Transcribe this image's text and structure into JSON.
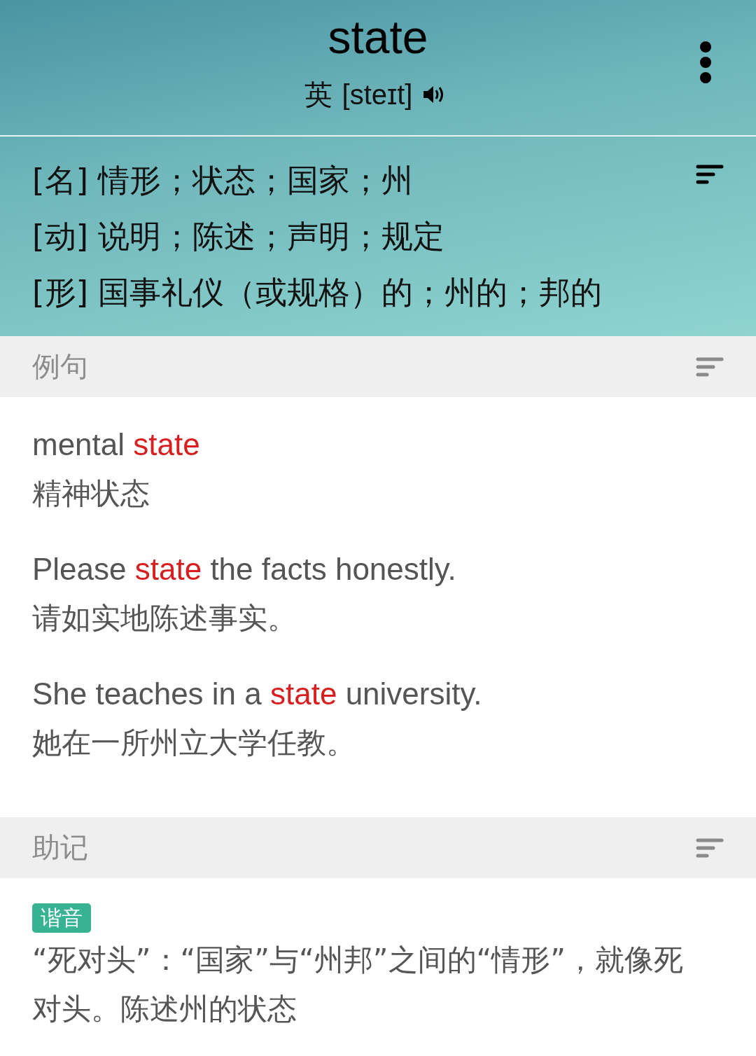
{
  "header": {
    "word": "state",
    "accent": "英",
    "phonetic": "[steɪt]"
  },
  "definitions": [
    {
      "pos": "[名]",
      "meaning": "情形；状态；国家；州"
    },
    {
      "pos": "[动]",
      "meaning": "说明；陈述；声明；规定"
    },
    {
      "pos": "[形]",
      "meaning": "国事礼仪（或规格）的；州的；邦的"
    }
  ],
  "examples_section": {
    "title": "例句",
    "items": [
      {
        "english": [
          {
            "text": "mental ",
            "highlight": false
          },
          {
            "text": "state",
            "highlight": true
          }
        ],
        "chinese": "精神状态"
      },
      {
        "english": [
          {
            "text": "Please ",
            "highlight": false
          },
          {
            "text": "state",
            "highlight": true
          },
          {
            "text": " the facts honestly.",
            "highlight": false
          }
        ],
        "chinese": "请如实地陈述事实。"
      },
      {
        "english": [
          {
            "text": "She teaches in a ",
            "highlight": false
          },
          {
            "text": "state",
            "highlight": true
          },
          {
            "text": " university.",
            "highlight": false
          }
        ],
        "chinese": "她在一所州立大学任教。"
      }
    ]
  },
  "mnemonic_section": {
    "title": "助记",
    "tag": "谐音",
    "text": "“死对头”：“国家”与“州邦”之间的“情形”，就像死对头。陈述州的状态"
  }
}
